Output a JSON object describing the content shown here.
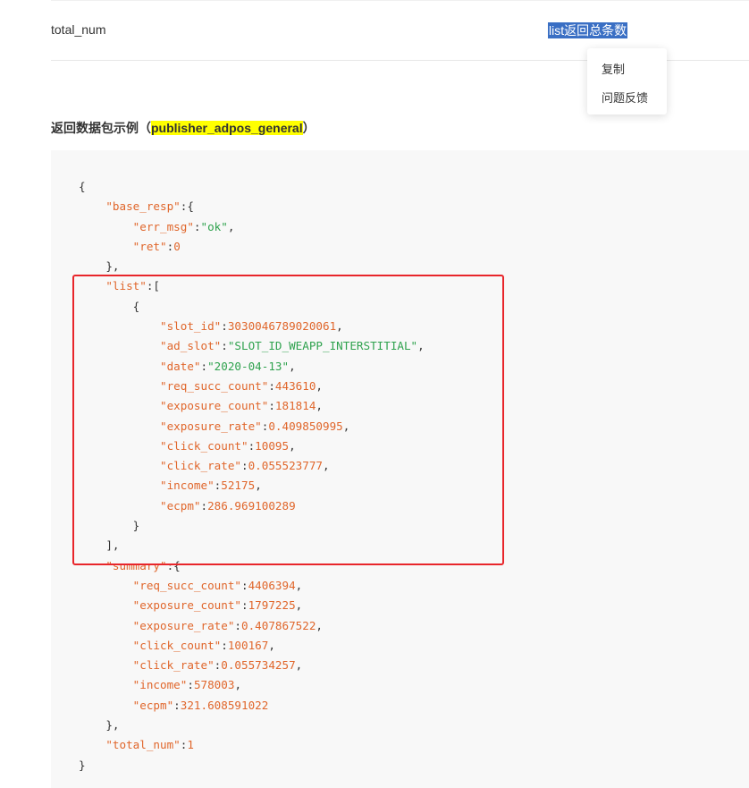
{
  "field_row": {
    "name": "total_num",
    "description": "list返回总条数"
  },
  "context_menu": {
    "copy": "复制",
    "feedback": "问题反馈"
  },
  "section": {
    "prefix": "返回数据包示例（",
    "highlight": "publisher_adpos_general",
    "suffix": "）"
  },
  "code_lines": [
    [
      [
        "p",
        "{"
      ]
    ],
    [
      [
        "p",
        "    "
      ],
      [
        "k",
        "\"base_resp\""
      ],
      [
        "p",
        ":{"
      ]
    ],
    [
      [
        "p",
        "        "
      ],
      [
        "k",
        "\"err_msg\""
      ],
      [
        "p",
        ":"
      ],
      [
        "s",
        "\"ok\""
      ],
      [
        "p",
        ","
      ]
    ],
    [
      [
        "p",
        "        "
      ],
      [
        "k",
        "\"ret\""
      ],
      [
        "p",
        ":"
      ],
      [
        "n",
        "0"
      ]
    ],
    [
      [
        "p",
        "    },"
      ]
    ],
    [
      [
        "p",
        "    "
      ],
      [
        "k",
        "\"list\""
      ],
      [
        "p",
        ":["
      ]
    ],
    [
      [
        "p",
        "        {"
      ]
    ],
    [
      [
        "p",
        "            "
      ],
      [
        "k",
        "\"slot_id\""
      ],
      [
        "p",
        ":"
      ],
      [
        "n",
        "3030046789020061"
      ],
      [
        "p",
        ","
      ]
    ],
    [
      [
        "p",
        "            "
      ],
      [
        "k",
        "\"ad_slot\""
      ],
      [
        "p",
        ":"
      ],
      [
        "s",
        "\"SLOT_ID_WEAPP_INTERSTITIAL\""
      ],
      [
        "p",
        ","
      ]
    ],
    [
      [
        "p",
        "            "
      ],
      [
        "k",
        "\"date\""
      ],
      [
        "p",
        ":"
      ],
      [
        "s",
        "\"2020-04-13\""
      ],
      [
        "p",
        ","
      ]
    ],
    [
      [
        "p",
        "            "
      ],
      [
        "k",
        "\"req_succ_count\""
      ],
      [
        "p",
        ":"
      ],
      [
        "n",
        "443610"
      ],
      [
        "p",
        ","
      ]
    ],
    [
      [
        "p",
        "            "
      ],
      [
        "k",
        "\"exposure_count\""
      ],
      [
        "p",
        ":"
      ],
      [
        "n",
        "181814"
      ],
      [
        "p",
        ","
      ]
    ],
    [
      [
        "p",
        "            "
      ],
      [
        "k",
        "\"exposure_rate\""
      ],
      [
        "p",
        ":"
      ],
      [
        "n",
        "0.409850995"
      ],
      [
        "p",
        ","
      ]
    ],
    [
      [
        "p",
        "            "
      ],
      [
        "k",
        "\"click_count\""
      ],
      [
        "p",
        ":"
      ],
      [
        "n",
        "10095"
      ],
      [
        "p",
        ","
      ]
    ],
    [
      [
        "p",
        "            "
      ],
      [
        "k",
        "\"click_rate\""
      ],
      [
        "p",
        ":"
      ],
      [
        "n",
        "0.055523777"
      ],
      [
        "p",
        ","
      ]
    ],
    [
      [
        "p",
        "            "
      ],
      [
        "k",
        "\"income\""
      ],
      [
        "p",
        ":"
      ],
      [
        "n",
        "52175"
      ],
      [
        "p",
        ","
      ]
    ],
    [
      [
        "p",
        "            "
      ],
      [
        "k",
        "\"ecpm\""
      ],
      [
        "p",
        ":"
      ],
      [
        "n",
        "286.969100289"
      ]
    ],
    [
      [
        "p",
        "        }"
      ]
    ],
    [
      [
        "p",
        "    ],"
      ]
    ],
    [
      [
        "p",
        "    "
      ],
      [
        "k",
        "\"summary\""
      ],
      [
        "p",
        ":{"
      ]
    ],
    [
      [
        "p",
        "        "
      ],
      [
        "k",
        "\"req_succ_count\""
      ],
      [
        "p",
        ":"
      ],
      [
        "n",
        "4406394"
      ],
      [
        "p",
        ","
      ]
    ],
    [
      [
        "p",
        "        "
      ],
      [
        "k",
        "\"exposure_count\""
      ],
      [
        "p",
        ":"
      ],
      [
        "n",
        "1797225"
      ],
      [
        "p",
        ","
      ]
    ],
    [
      [
        "p",
        "        "
      ],
      [
        "k",
        "\"exposure_rate\""
      ],
      [
        "p",
        ":"
      ],
      [
        "n",
        "0.407867522"
      ],
      [
        "p",
        ","
      ]
    ],
    [
      [
        "p",
        "        "
      ],
      [
        "k",
        "\"click_count\""
      ],
      [
        "p",
        ":"
      ],
      [
        "n",
        "100167"
      ],
      [
        "p",
        ","
      ]
    ],
    [
      [
        "p",
        "        "
      ],
      [
        "k",
        "\"click_rate\""
      ],
      [
        "p",
        ":"
      ],
      [
        "n",
        "0.055734257"
      ],
      [
        "p",
        ","
      ]
    ],
    [
      [
        "p",
        "        "
      ],
      [
        "k",
        "\"income\""
      ],
      [
        "p",
        ":"
      ],
      [
        "n",
        "578003"
      ],
      [
        "p",
        ","
      ]
    ],
    [
      [
        "p",
        "        "
      ],
      [
        "k",
        "\"ecpm\""
      ],
      [
        "p",
        ":"
      ],
      [
        "n",
        "321.608591022"
      ]
    ],
    [
      [
        "p",
        "    },"
      ]
    ],
    [
      [
        "p",
        "    "
      ],
      [
        "k",
        "\"total_num\""
      ],
      [
        "p",
        ":"
      ],
      [
        "n",
        "1"
      ]
    ],
    [
      [
        "p",
        "}"
      ]
    ]
  ],
  "colors": {
    "key": "#e0662b",
    "string": "#2fa24e",
    "number": "#e0662b",
    "annotation_box": "#e8262b",
    "selection": "#3a6fc4"
  }
}
